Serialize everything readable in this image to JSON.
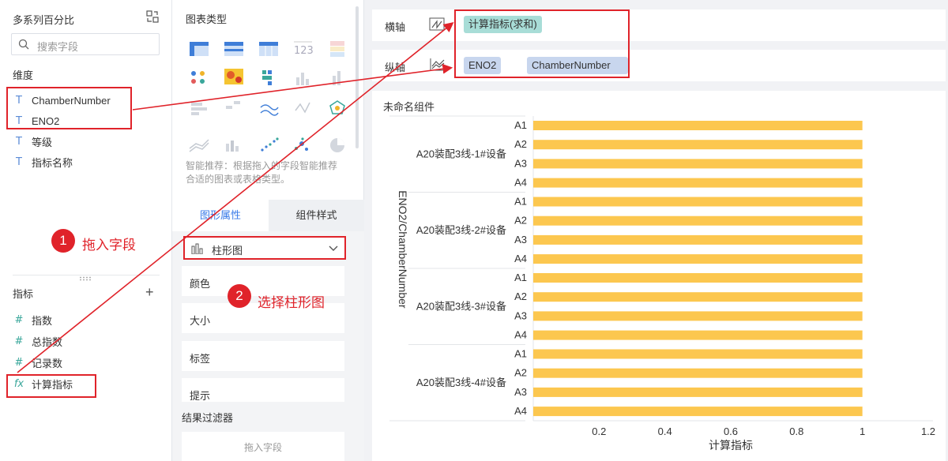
{
  "left": {
    "title": "多系列百分比",
    "search_placeholder": "搜索字段",
    "dimension_label": "维度",
    "dimensions": [
      {
        "icon": "text-field-icon",
        "glyph": "T",
        "label": "ChamberNumber"
      },
      {
        "icon": "text-field-icon",
        "glyph": "T",
        "label": "ENO2"
      },
      {
        "icon": "text-field-icon",
        "glyph": "T",
        "label": "等级"
      },
      {
        "icon": "text-field-icon",
        "glyph": "T",
        "label": "指标名称"
      }
    ],
    "metric_label": "指标",
    "metrics": [
      {
        "icon": "number-field-icon",
        "glyph": "#",
        "label": "指数"
      },
      {
        "icon": "number-field-icon",
        "glyph": "#",
        "label": "总指数"
      },
      {
        "icon": "number-field-icon",
        "glyph": "#",
        "label": "记录数"
      },
      {
        "icon": "formula-field-icon",
        "glyph": "fx",
        "label": "计算指标"
      }
    ]
  },
  "middle": {
    "chart_types_title": "图表类型",
    "recommend_text": "智能推荐：根据拖入的字段智能推荐合适的图表或表格类型。",
    "tabs": [
      "图形属性",
      "组件样式"
    ],
    "chart_type_selected": "柱形图",
    "properties": [
      "颜色",
      "大小",
      "标签",
      "提示"
    ],
    "filter_title": "结果过滤器",
    "drop_hint": "拖入字段"
  },
  "right": {
    "x_axis_label": "横轴",
    "y_axis_label": "纵轴",
    "x_axis_fields": [
      "计算指标(求和)"
    ],
    "y_axis_fields": [
      "ENO2",
      "ChamberNumber"
    ],
    "component_title": "未命名组件"
  },
  "annotations": {
    "step1_num": "1",
    "step1_text": "拖入字段",
    "step2_num": "2",
    "step2_text": "选择柱形图"
  },
  "colors": {
    "accent": "#3a7be8",
    "bar": "#fcc74f",
    "annotation": "#e0232a"
  },
  "chart_data": {
    "type": "bar",
    "orientation": "horizontal",
    "groups": [
      "A20装配3线-1#设备",
      "A20装配3线-2#设备",
      "A20装配3线-3#设备",
      "A20装配3线-4#设备"
    ],
    "categories": [
      "A1",
      "A2",
      "A3",
      "A4"
    ],
    "values": [
      [
        1,
        1,
        1,
        1
      ],
      [
        1,
        1,
        1,
        1
      ],
      [
        1,
        1,
        1,
        1
      ],
      [
        1,
        1,
        1,
        1
      ]
    ],
    "xlabel": "计算指标",
    "ylabel": "ENO2/ChamberNumber",
    "xticks": [
      "0.2",
      "0.4",
      "0.6",
      "0.8",
      "1",
      "1.2"
    ],
    "xlim": [
      0,
      1.2
    ]
  }
}
